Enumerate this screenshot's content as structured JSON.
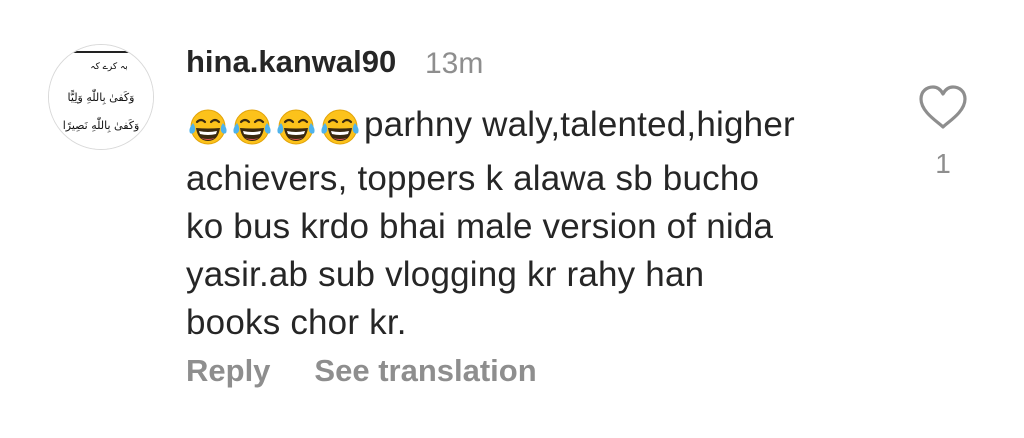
{
  "comment": {
    "username": "hina.kanwal90",
    "timestamp": "13m",
    "emojis": [
      "laughing-tears-icon",
      "laughing-tears-icon",
      "laughing-tears-icon",
      "laughing-tears-icon"
    ],
    "text_lines": [
      "parhny waly,talented,higher",
      "achievers,  toppers k alawa sb bucho",
      "ko bus krdo bhai male version of nida",
      "yasir.ab sub vlogging kr rahy han",
      "books chor kr."
    ],
    "like_count": "1",
    "reply_label": "Reply",
    "translate_label": "See translation"
  },
  "avatar": {
    "lines": [
      "بہ کرے کہ",
      "وَكَفىٰ بِاللّٰهِ وَلِيًّا",
      "وَكَفىٰ بِاللّٰهِ نَصِيرًا"
    ]
  },
  "colors": {
    "primary_text": "#262626",
    "secondary_text": "#8e8e8e",
    "background": "#ffffff"
  }
}
